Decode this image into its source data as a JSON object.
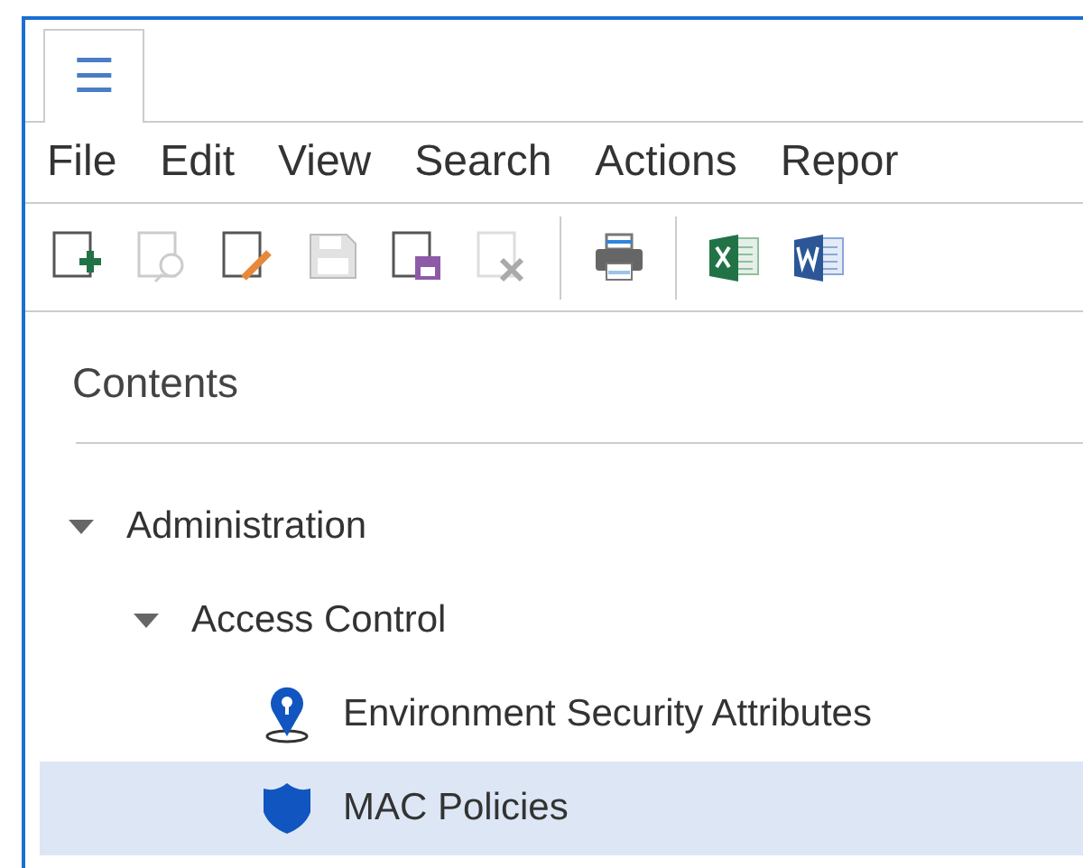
{
  "tab": {
    "icon": "☰",
    "selected": true
  },
  "menu": [
    "File",
    "Edit",
    "View",
    "Search",
    "Actions",
    "Repor"
  ],
  "toolbar": [
    {
      "kind": "new",
      "disabled": false
    },
    {
      "kind": "preview",
      "disabled": true
    },
    {
      "kind": "edit",
      "disabled": false
    },
    {
      "kind": "save",
      "disabled": true
    },
    {
      "kind": "saveas",
      "disabled": false
    },
    {
      "kind": "delete",
      "disabled": true
    },
    {
      "kind": "separator"
    },
    {
      "kind": "print",
      "disabled": false
    },
    {
      "kind": "separator"
    },
    {
      "kind": "excel",
      "disabled": false
    },
    {
      "kind": "word",
      "disabled": false
    }
  ],
  "contents": {
    "title": "Contents",
    "tree": [
      {
        "label": "Administration",
        "expanded": true,
        "selected": false,
        "children": [
          {
            "label": "Access Control",
            "expanded": true,
            "selected": false,
            "children": [
              {
                "label": "Environment Security Attributes",
                "kind": "pin",
                "selected": false
              },
              {
                "label": "MAC Policies",
                "kind": "shield",
                "selected": true
              }
            ]
          }
        ]
      }
    ]
  }
}
